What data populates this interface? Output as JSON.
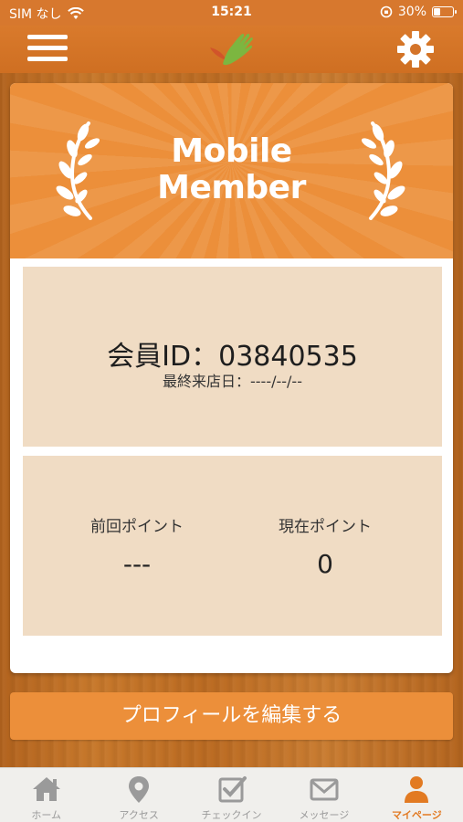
{
  "status_bar": {
    "carrier": "SIM なし",
    "time": "15:21",
    "battery": "30%"
  },
  "card": {
    "banner_title_line1": "Mobile",
    "banner_title_line2": "Member",
    "member_id": "会員ID：03840535",
    "last_visit": "最終来店日：----/--/--",
    "previous_points_label": "前回ポイント",
    "previous_points_value": "---",
    "current_points_label": "現在ポイント",
    "current_points_value": "0"
  },
  "edit_profile_button": "プロフィールを編集する",
  "tabs": [
    {
      "label": "ホーム",
      "icon": "home-icon"
    },
    {
      "label": "アクセス",
      "icon": "map-pin-icon"
    },
    {
      "label": "チェックイン",
      "icon": "checkbox-icon"
    },
    {
      "label": "メッセージ",
      "icon": "mail-icon"
    },
    {
      "label": "マイページ",
      "icon": "person-icon"
    }
  ],
  "colors": {
    "accent": "#ec8f3a",
    "header": "#d97a2c",
    "panel": "#f0dcc4",
    "active_tab": "#e27a22",
    "inactive_tab": "#9a9a9a"
  }
}
